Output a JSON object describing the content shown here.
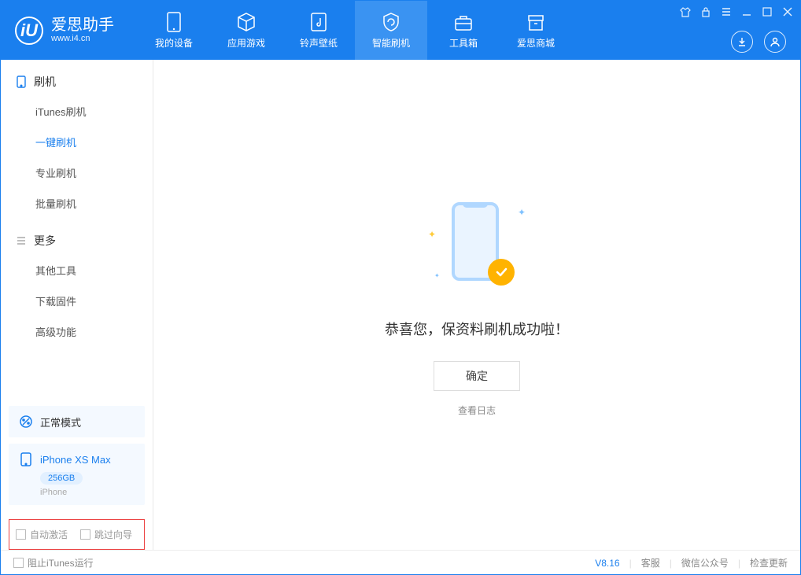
{
  "app": {
    "logo_letter": "iU",
    "title": "爱思助手",
    "url": "www.i4.cn"
  },
  "tabs": {
    "device": "我的设备",
    "apps": "应用游戏",
    "ringtone": "铃声壁纸",
    "flash": "智能刷机",
    "toolbox": "工具箱",
    "store": "爱思商城"
  },
  "sidebar": {
    "section1_title": "刷机",
    "items1": {
      "itunes": "iTunes刷机",
      "oneclick": "一键刷机",
      "pro": "专业刷机",
      "batch": "批量刷机"
    },
    "section2_title": "更多",
    "items2": {
      "other": "其他工具",
      "firmware": "下载固件",
      "advanced": "高级功能"
    }
  },
  "status_card": {
    "mode_label": "正常模式",
    "device_name": "iPhone XS Max",
    "capacity": "256GB",
    "device_type": "iPhone"
  },
  "options": {
    "auto_activate": "自动激活",
    "skip_guide": "跳过向导"
  },
  "main": {
    "success_title": "恭喜您，保资料刷机成功啦！",
    "confirm": "确定",
    "view_log": "查看日志"
  },
  "footer": {
    "block_itunes": "阻止iTunes运行",
    "version": "V8.16",
    "support": "客服",
    "wechat": "微信公众号",
    "update": "检查更新"
  }
}
